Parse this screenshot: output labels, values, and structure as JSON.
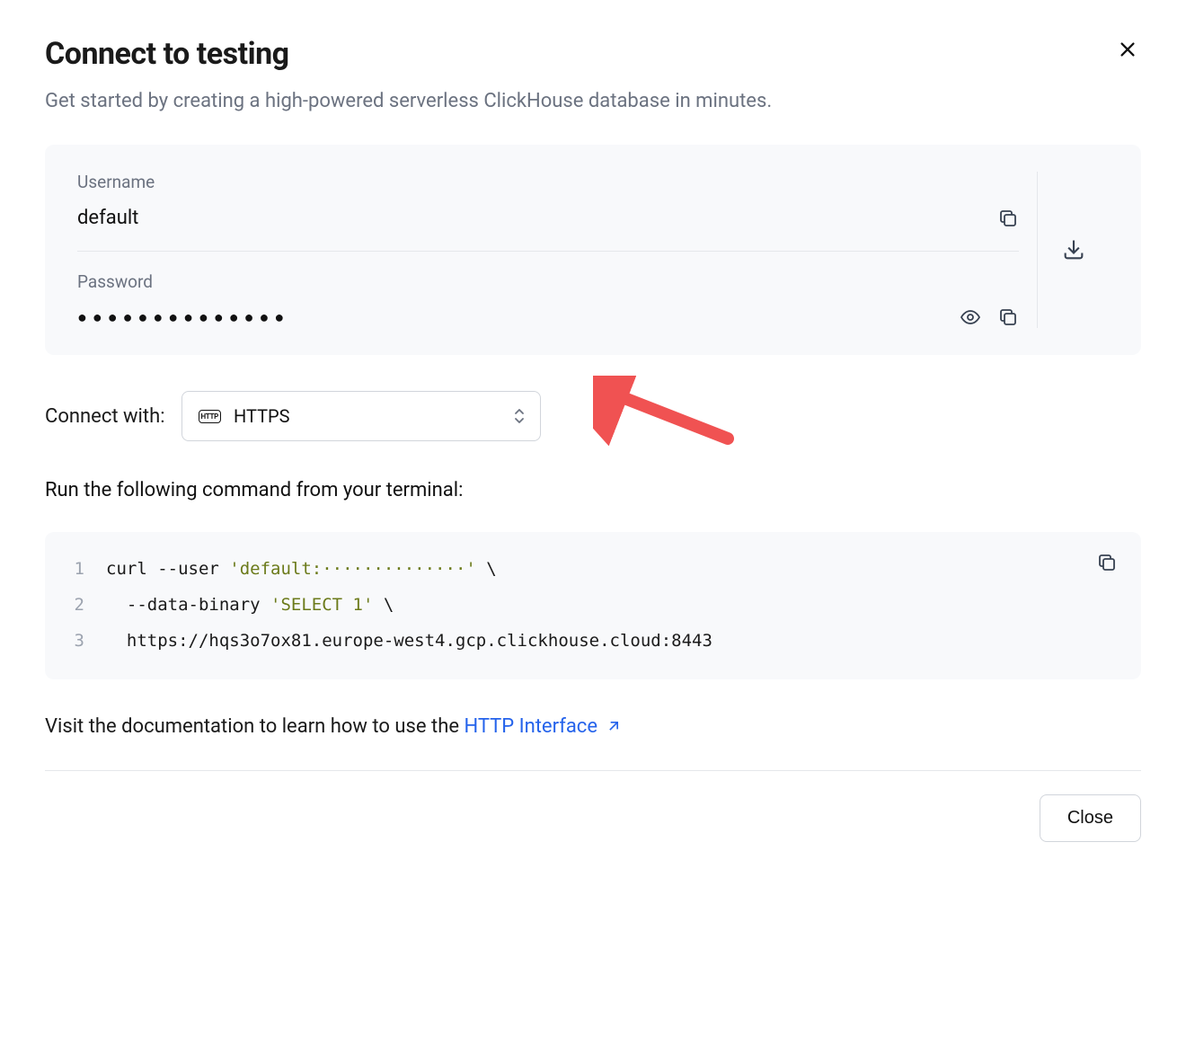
{
  "header": {
    "title": "Connect to testing",
    "subtitle": "Get started by creating a high-powered serverless ClickHouse database in minutes."
  },
  "credentials": {
    "username_label": "Username",
    "username_value": "default",
    "password_label": "Password",
    "password_mask": "●●●●●●●●●●●●●●"
  },
  "connect": {
    "label": "Connect with:",
    "protocol_badge": "HTTP",
    "selected": "HTTPS"
  },
  "run_instruction": "Run the following command from your terminal:",
  "code": {
    "line1_prefix": "curl --user ",
    "line1_string": "'default:··············'",
    "line1_suffix": " \\",
    "line2_prefix": "  --data-binary ",
    "line2_string": "'SELECT 1'",
    "line2_suffix": " \\",
    "line3": "  https://hqs3o7ox81.europe-west4.gcp.clickhouse.cloud:8443",
    "lineno1": "1",
    "lineno2": "2",
    "lineno3": "3"
  },
  "doc": {
    "prefix": "Visit the documentation to learn how to use the ",
    "link_text": "HTTP Interface"
  },
  "footer": {
    "close_label": "Close"
  }
}
